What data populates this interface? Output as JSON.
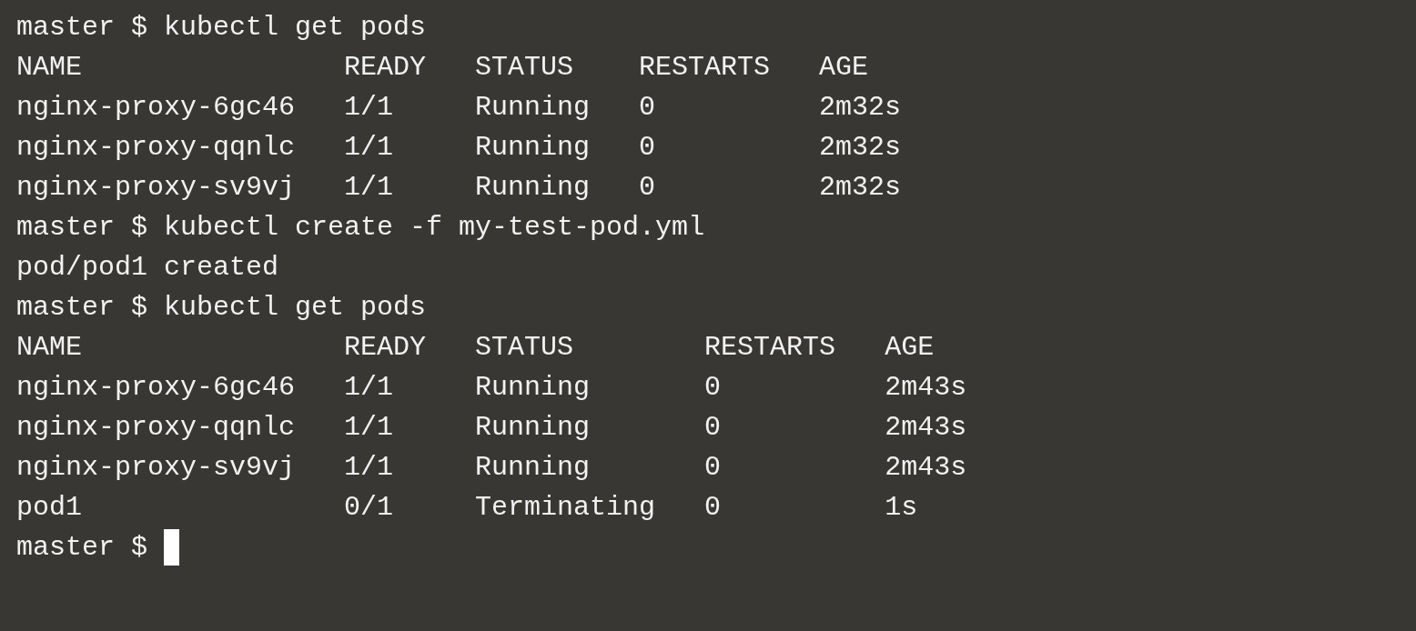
{
  "terminal": {
    "blocks": [
      {
        "kind": "prompt",
        "prompt": "master $",
        "command": "kubectl get pods"
      },
      {
        "kind": "table",
        "columns": [
          "NAME",
          "READY",
          "STATUS",
          "RESTARTS",
          "AGE"
        ],
        "rows": [
          [
            "nginx-proxy-6gc46",
            "1/1",
            "Running",
            "0",
            "2m32s"
          ],
          [
            "nginx-proxy-qqnlc",
            "1/1",
            "Running",
            "0",
            "2m32s"
          ],
          [
            "nginx-proxy-sv9vj",
            "1/1",
            "Running",
            "0",
            "2m32s"
          ]
        ]
      },
      {
        "kind": "prompt",
        "prompt": "master $",
        "command": "kubectl create -f my-test-pod.yml"
      },
      {
        "kind": "output",
        "text": "pod/pod1 created"
      },
      {
        "kind": "prompt",
        "prompt": "master $",
        "command": "kubectl get pods"
      },
      {
        "kind": "table",
        "columns": [
          "NAME",
          "READY",
          "STATUS",
          "RESTARTS",
          "AGE"
        ],
        "rows": [
          [
            "nginx-proxy-6gc46",
            "1/1",
            "Running",
            "0",
            "2m43s"
          ],
          [
            "nginx-proxy-qqnlc",
            "1/1",
            "Running",
            "0",
            "2m43s"
          ],
          [
            "nginx-proxy-sv9vj",
            "1/1",
            "Running",
            "0",
            "2m43s"
          ],
          [
            "pod1",
            "0/1",
            "Terminating",
            "0",
            "1s"
          ]
        ]
      },
      {
        "kind": "prompt",
        "prompt": "master $",
        "cursor": true
      }
    ]
  }
}
